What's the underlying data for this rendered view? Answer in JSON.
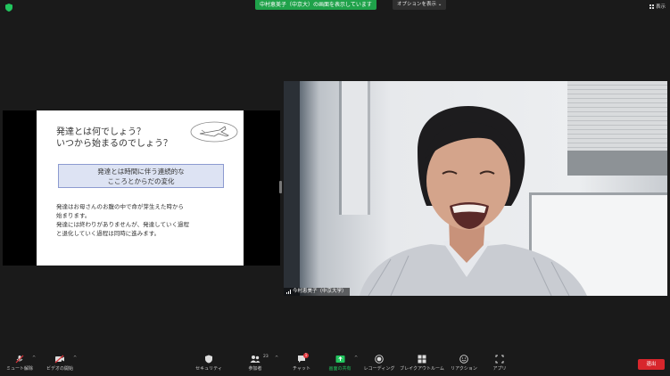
{
  "topbar": {
    "share_banner": "中村恵美子（中京大）の画面を表示しています",
    "view_options": "オプションを表示 ⌄",
    "view_button": "表示"
  },
  "slide": {
    "title": "発達とは何でしょう？\nいつから始まるのでしょう？",
    "box": "発達とは時間に伴う連続的な\nこころとからだの変化",
    "body": "発達はお母さんのお腹の中で命が芽生えた時から\n始まります。\n発達には終わりがありませんが、発達していく過程\nと退化していく過程は同時に進みます。"
  },
  "video": {
    "name": "今村恵美子（中京大学）"
  },
  "toolbar": {
    "mute": "ミュート解除",
    "video": "ビデオの開始",
    "security": "セキュリティ",
    "participants": "参加者",
    "participants_count": "23",
    "chat": "チャット",
    "chat_badge": "1",
    "share": "画面の共有",
    "record": "レコーディング",
    "breakout": "ブレイクアウトルーム",
    "reactions": "リアクション",
    "apps": "アプリ",
    "end": "退出"
  },
  "colors": {
    "share_green": "#1fa24a",
    "end_red": "#d8262c"
  }
}
